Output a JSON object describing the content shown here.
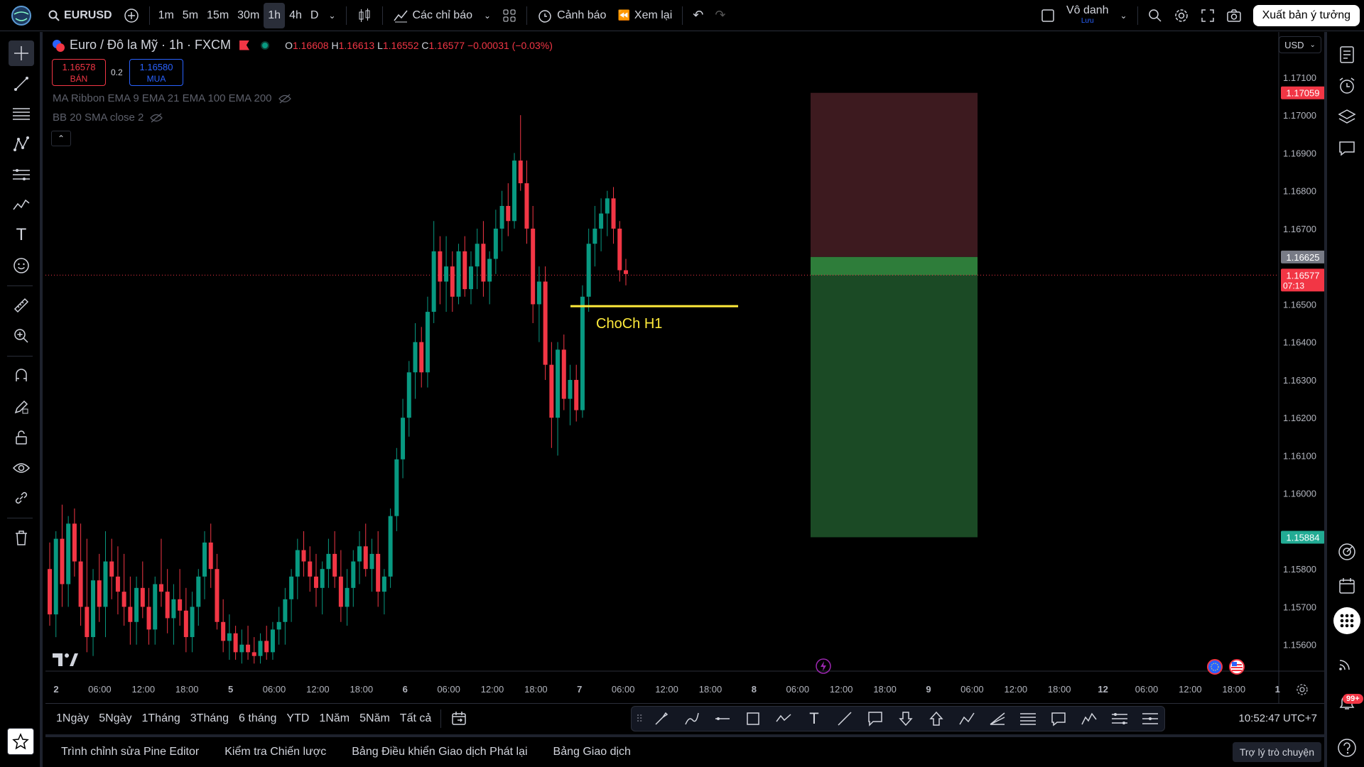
{
  "topbar": {
    "symbol": "EURUSD",
    "timeframes": [
      "1m",
      "5m",
      "15m",
      "30m",
      "1h",
      "4h",
      "D"
    ],
    "active_timeframe": "1h",
    "indicators_label": "Các chỉ báo",
    "alert_label": "Cảnh báo",
    "replay_label": "Xem lại",
    "layout_name": "Vô danh",
    "layout_status": "Lưu",
    "publish_label": "Xuất bản ý tưởng"
  },
  "legend": {
    "title": "Euro / Đô la Mỹ · 1h · FXCM",
    "o_label": "O",
    "o": "1.16608",
    "h_label": "H",
    "h": "1.16613",
    "l_label": "L",
    "l": "1.16552",
    "c_label": "C",
    "c": "1.16577",
    "change": "−0.00031 (−0.03%)",
    "sell_price": "1.16578",
    "sell_label": "BÁN",
    "spread": "0.2",
    "buy_price": "1.16580",
    "buy_label": "MUA",
    "indicator1": "MA Ribbon EMA 9 EMA 21 EMA 100 EMA 200",
    "indicator2": "BB 20 SMA close 2"
  },
  "annotation": {
    "label": "ChoCh H1",
    "color": "#ffeb3b"
  },
  "price_axis": {
    "currency": "USD",
    "ticks": [
      "1.17100",
      "1.17000",
      "1.16900",
      "1.16800",
      "1.16700",
      "1.16500",
      "1.16400",
      "1.16300",
      "1.16200",
      "1.16100",
      "1.16000",
      "1.15800",
      "1.15700",
      "1.15600"
    ],
    "tag_stop": "1.17059",
    "tag_entry": "1.16625",
    "tag_last": "1.16577",
    "countdown": "07:13",
    "tag_target": "1.15884"
  },
  "time_axis": {
    "labels": [
      "2",
      "06:00",
      "12:00",
      "18:00",
      "5",
      "06:00",
      "12:00",
      "18:00",
      "6",
      "06:00",
      "12:00",
      "18:00",
      "7",
      "06:00",
      "12:00",
      "18:00",
      "8",
      "06:00",
      "12:00",
      "18:00",
      "9",
      "06:00",
      "12:00",
      "18:00",
      "12",
      "06:00",
      "12:00",
      "18:00",
      "1"
    ]
  },
  "bottom": {
    "ranges": [
      "1Ngày",
      "5Ngày",
      "1Tháng",
      "3Tháng",
      "6 tháng",
      "YTD",
      "1Năm",
      "5Năm",
      "Tất cả"
    ],
    "clock": "10:52:47 UTC+7"
  },
  "footer": {
    "tabs": [
      "Trình chỉnh sửa Pine Editor",
      "Kiểm tra Chiến lược",
      "Bảng Điều khiển Giao dịch Phát lại",
      "Bảng Giao dịch"
    ],
    "assistant": "Trợ lý trò chuyện",
    "notif_count": "99+"
  },
  "colors": {
    "up": "#089981",
    "down": "#f23645",
    "stop_zone": "#3d1a1f",
    "target_zone": "#1b4a25"
  },
  "chart_data": {
    "type": "candlestick",
    "ylim": [
      1.1553,
      1.1722
    ],
    "candles": [
      [
        1.158,
        1.1587,
        1.1565,
        1.1568
      ],
      [
        1.1568,
        1.159,
        1.1562,
        1.1588
      ],
      [
        1.1588,
        1.1597,
        1.157,
        1.1576
      ],
      [
        1.1576,
        1.1594,
        1.157,
        1.1592
      ],
      [
        1.1592,
        1.1596,
        1.1578,
        1.1582
      ],
      [
        1.1582,
        1.1592,
        1.1565,
        1.157
      ],
      [
        1.157,
        1.1588,
        1.1558,
        1.1562
      ],
      [
        1.1562,
        1.158,
        1.1557,
        1.1577
      ],
      [
        1.1577,
        1.1584,
        1.1566,
        1.157
      ],
      [
        1.157,
        1.159,
        1.1562,
        1.1582
      ],
      [
        1.1582,
        1.1588,
        1.1572,
        1.1578
      ],
      [
        1.1578,
        1.1586,
        1.1568,
        1.1574
      ],
      [
        1.1574,
        1.1584,
        1.1565,
        1.157
      ],
      [
        1.157,
        1.1578,
        1.156,
        1.1566
      ],
      [
        1.1566,
        1.1578,
        1.156,
        1.1575
      ],
      [
        1.1575,
        1.1582,
        1.1567,
        1.157
      ],
      [
        1.157,
        1.1575,
        1.156,
        1.1564
      ],
      [
        1.1564,
        1.1578,
        1.156,
        1.1576
      ],
      [
        1.1576,
        1.1588,
        1.157,
        1.1574
      ],
      [
        1.1574,
        1.158,
        1.1563,
        1.1567
      ],
      [
        1.1567,
        1.1576,
        1.156,
        1.1572
      ],
      [
        1.1572,
        1.158,
        1.1565,
        1.1569
      ],
      [
        1.1569,
        1.1575,
        1.1558,
        1.1562
      ],
      [
        1.1562,
        1.1574,
        1.1558,
        1.157
      ],
      [
        1.157,
        1.158,
        1.1565,
        1.1578
      ],
      [
        1.1578,
        1.159,
        1.1572,
        1.1587
      ],
      [
        1.1587,
        1.1592,
        1.1575,
        1.158
      ],
      [
        1.158,
        1.1584,
        1.1564,
        1.1566
      ],
      [
        1.1566,
        1.1572,
        1.1558,
        1.1561
      ],
      [
        1.1561,
        1.1568,
        1.1556,
        1.1563
      ],
      [
        1.1563,
        1.1565,
        1.1556,
        1.1558
      ],
      [
        1.1558,
        1.1564,
        1.1555,
        1.156
      ],
      [
        1.156,
        1.1565,
        1.1556,
        1.1558
      ],
      [
        1.1558,
        1.1562,
        1.1555,
        1.1557
      ],
      [
        1.1557,
        1.1563,
        1.1555,
        1.1561
      ],
      [
        1.1561,
        1.1565,
        1.1556,
        1.1558
      ],
      [
        1.1558,
        1.1566,
        1.1556,
        1.1564
      ],
      [
        1.1564,
        1.157,
        1.156,
        1.1566
      ],
      [
        1.1566,
        1.1575,
        1.156,
        1.1572
      ],
      [
        1.1572,
        1.158,
        1.1566,
        1.1578
      ],
      [
        1.1578,
        1.1588,
        1.1572,
        1.1585
      ],
      [
        1.1585,
        1.159,
        1.1578,
        1.1582
      ],
      [
        1.1582,
        1.1586,
        1.1574,
        1.1578
      ],
      [
        1.1578,
        1.1584,
        1.157,
        1.1575
      ],
      [
        1.1575,
        1.1582,
        1.1568,
        1.158
      ],
      [
        1.158,
        1.1588,
        1.1575,
        1.1584
      ],
      [
        1.1584,
        1.159,
        1.1575,
        1.1578
      ],
      [
        1.1578,
        1.1585,
        1.1566,
        1.157
      ],
      [
        1.157,
        1.158,
        1.1565,
        1.1575
      ],
      [
        1.1575,
        1.1585,
        1.157,
        1.1582
      ],
      [
        1.1582,
        1.159,
        1.1576,
        1.1586
      ],
      [
        1.1586,
        1.1592,
        1.1578,
        1.158
      ],
      [
        1.158,
        1.1588,
        1.1574,
        1.1584
      ],
      [
        1.1584,
        1.159,
        1.157,
        1.1574
      ],
      [
        1.1574,
        1.158,
        1.1568,
        1.1578
      ],
      [
        1.1578,
        1.1596,
        1.1575,
        1.1594
      ],
      [
        1.1594,
        1.1612,
        1.159,
        1.1609
      ],
      [
        1.1609,
        1.1625,
        1.1604,
        1.162
      ],
      [
        1.162,
        1.1635,
        1.1615,
        1.1632
      ],
      [
        1.1632,
        1.1645,
        1.1625,
        1.164
      ],
      [
        1.164,
        1.1644,
        1.1628,
        1.1632
      ],
      [
        1.1632,
        1.1652,
        1.1628,
        1.1648
      ],
      [
        1.1648,
        1.1672,
        1.1645,
        1.1664
      ],
      [
        1.1664,
        1.1668,
        1.165,
        1.1656
      ],
      [
        1.1656,
        1.1668,
        1.1648,
        1.166
      ],
      [
        1.166,
        1.1664,
        1.1648,
        1.1652
      ],
      [
        1.1652,
        1.1666,
        1.165,
        1.1664
      ],
      [
        1.1664,
        1.1668,
        1.1652,
        1.1654
      ],
      [
        1.1654,
        1.1664,
        1.165,
        1.166
      ],
      [
        1.166,
        1.167,
        1.1654,
        1.1666
      ],
      [
        1.1666,
        1.1672,
        1.1652,
        1.1656
      ],
      [
        1.1656,
        1.1664,
        1.165,
        1.1662
      ],
      [
        1.1662,
        1.1675,
        1.1658,
        1.167
      ],
      [
        1.167,
        1.168,
        1.1664,
        1.1676
      ],
      [
        1.1676,
        1.1682,
        1.1668,
        1.1672
      ],
      [
        1.1672,
        1.169,
        1.167,
        1.1688
      ],
      [
        1.1688,
        1.17,
        1.168,
        1.1682
      ],
      [
        1.1682,
        1.1688,
        1.1666,
        1.167
      ],
      [
        1.167,
        1.1676,
        1.1645,
        1.165
      ],
      [
        1.165,
        1.166,
        1.164,
        1.1656
      ],
      [
        1.1656,
        1.166,
        1.163,
        1.1634
      ],
      [
        1.1634,
        1.164,
        1.1612,
        1.162
      ],
      [
        1.162,
        1.164,
        1.161,
        1.1638
      ],
      [
        1.1638,
        1.1642,
        1.1622,
        1.1625
      ],
      [
        1.1625,
        1.1634,
        1.1618,
        1.163
      ],
      [
        1.163,
        1.1634,
        1.1619,
        1.1622
      ],
      [
        1.1622,
        1.1655,
        1.162,
        1.1652
      ],
      [
        1.1652,
        1.167,
        1.1648,
        1.1666
      ],
      [
        1.1666,
        1.1676,
        1.166,
        1.167
      ],
      [
        1.167,
        1.1678,
        1.1664,
        1.1674
      ],
      [
        1.1674,
        1.168,
        1.1668,
        1.1678
      ],
      [
        1.1678,
        1.1681,
        1.1666,
        1.167
      ],
      [
        1.167,
        1.1672,
        1.1656,
        1.1659
      ],
      [
        1.1659,
        1.1662,
        1.1655,
        1.1658
      ]
    ],
    "trade": {
      "stop": 1.17059,
      "entry": 1.16625,
      "target": 1.15884
    },
    "choch_price": 1.16495,
    "last_price": 1.16577
  }
}
